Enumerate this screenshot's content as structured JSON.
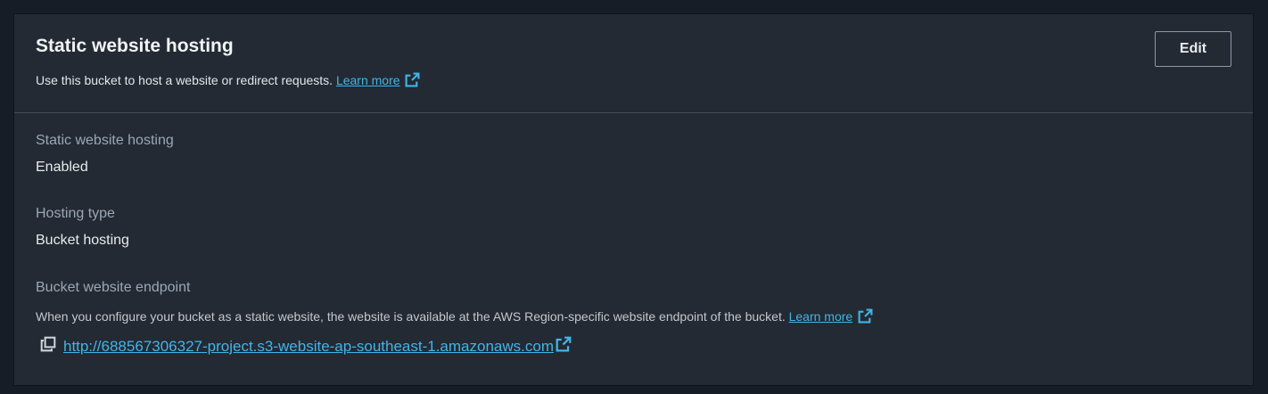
{
  "section": {
    "title": "Static website hosting",
    "subtitle": "Use this bucket to host a website or redirect requests.",
    "learn_more": "Learn more",
    "edit_label": "Edit"
  },
  "fields": {
    "hosting_label": "Static website hosting",
    "hosting_value": "Enabled",
    "type_label": "Hosting type",
    "type_value": "Bucket hosting",
    "endpoint_label": "Bucket website endpoint",
    "endpoint_description": "When you configure your bucket as a static website, the website is available at the AWS Region-specific website endpoint of the bucket.",
    "endpoint_learn_more": "Learn more",
    "endpoint_url": "http://688567306327-project.s3-website-ap-southeast-1.amazonaws.com"
  },
  "icons": {
    "external_link": "external-link-icon",
    "copy": "copy-icon"
  },
  "colors": {
    "background": "#161d26",
    "panel": "#232a33",
    "link": "#42b4e6",
    "divider": "#414d5c"
  }
}
